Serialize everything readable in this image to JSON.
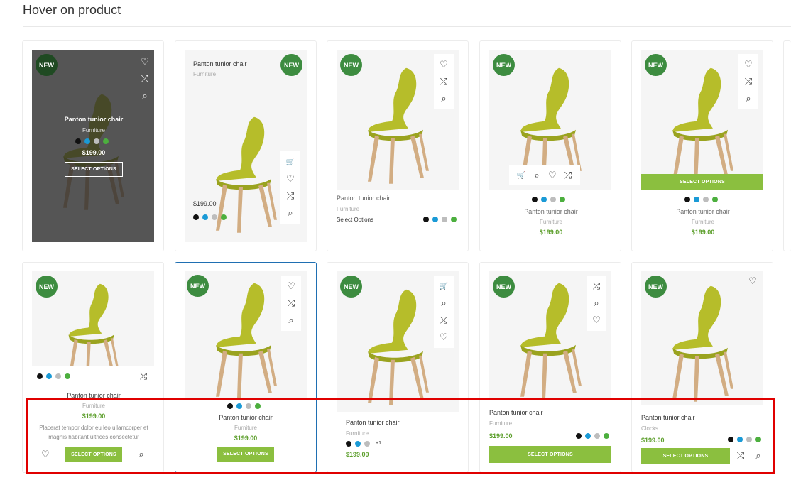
{
  "section_title": "Hover on product",
  "product": {
    "name": "Panton tunior chair",
    "category": "Furniture",
    "category_alt": "Clocks",
    "price": "$199.00",
    "select_options": "SELECT OPTIONS",
    "select_options_text": "Select Options",
    "description": "Placerat tempor dolor eu leo ullamcorper et magnis habitant ultrices consectetur",
    "badge": "NEW",
    "more_colors": "+1"
  },
  "swatch_colors": [
    "#111111",
    "#1a9ad6",
    "#bdbdbd",
    "#4caf3e"
  ],
  "accent_color": "#8bbf3f",
  "badge_color": "#3d8c40",
  "icons": {
    "wishlist": "♡",
    "compare": "⤮",
    "quickview": "⌕",
    "cart": "🛒"
  }
}
